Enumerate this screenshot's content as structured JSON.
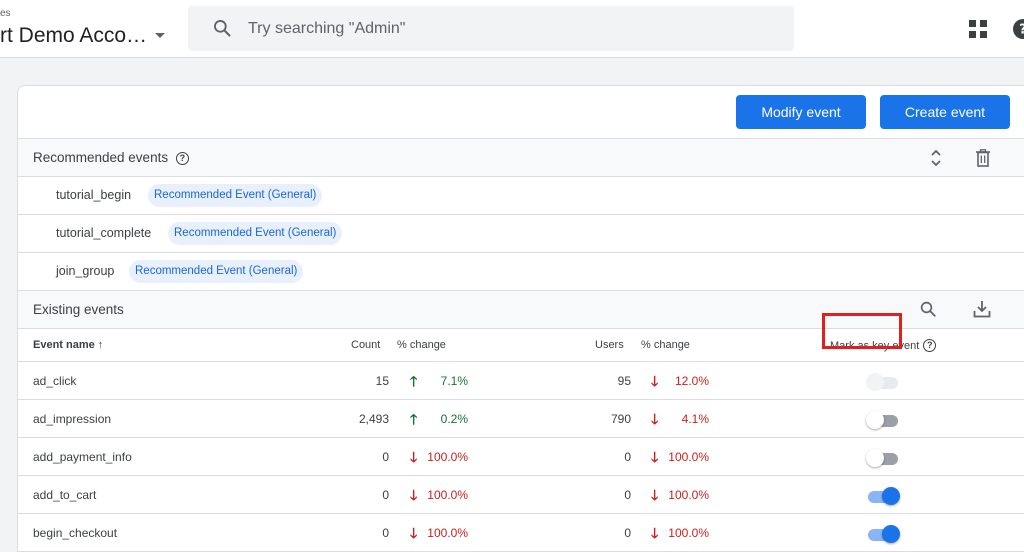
{
  "header": {
    "crumb": "es",
    "account": "rt Demo Acco…",
    "search_placeholder": "Try searching \"Admin\""
  },
  "toolbar": {
    "modify_label": "Modify event",
    "create_label": "Create event"
  },
  "recommended": {
    "title": "Recommended events",
    "items": [
      {
        "name": "tutorial_begin",
        "chip": "Recommended Event (General)"
      },
      {
        "name": "tutorial_complete",
        "chip": "Recommended Event (General)"
      },
      {
        "name": "join_group",
        "chip": "Recommended Event (General)"
      }
    ]
  },
  "existing": {
    "title": "Existing events",
    "columns": {
      "name": "Event name",
      "sort_arrow": "↑",
      "count": "Count",
      "count_change": "% change",
      "users": "Users",
      "users_change": "% change",
      "key_event": "Mark as key event"
    },
    "rows": [
      {
        "name": "ad_click",
        "count": "15",
        "count_dir": "up",
        "count_change": "7.1%",
        "users": "95",
        "users_dir": "down",
        "users_change": "12.0%",
        "key_event": "disabled"
      },
      {
        "name": "ad_impression",
        "count": "2,493",
        "count_dir": "up",
        "count_change": "0.2%",
        "users": "790",
        "users_dir": "down",
        "users_change": "4.1%",
        "key_event": "off"
      },
      {
        "name": "add_payment_info",
        "count": "0",
        "count_dir": "down",
        "count_change": "100.0%",
        "users": "0",
        "users_dir": "down",
        "users_change": "100.0%",
        "key_event": "off"
      },
      {
        "name": "add_to_cart",
        "count": "0",
        "count_dir": "down",
        "count_change": "100.0%",
        "users": "0",
        "users_dir": "down",
        "users_change": "100.0%",
        "key_event": "on"
      },
      {
        "name": "begin_checkout",
        "count": "0",
        "count_dir": "down",
        "count_change": "100.0%",
        "users": "0",
        "users_dir": "down",
        "users_change": "100.0%",
        "key_event": "on"
      }
    ]
  },
  "colors": {
    "accent": "#1a73e8",
    "up": "#137333",
    "down": "#c5221f",
    "highlight": "#e01f1f"
  }
}
